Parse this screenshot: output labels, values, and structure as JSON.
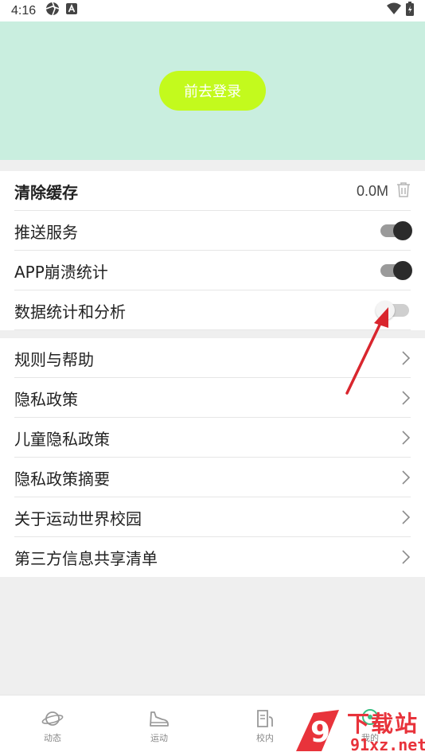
{
  "status_bar": {
    "time": "4:16"
  },
  "header": {
    "login_button": "前去登录"
  },
  "settings": {
    "clear_cache": {
      "label": "清除缓存",
      "size": "0.0M"
    },
    "push_service": {
      "label": "推送服务",
      "enabled": true
    },
    "crash_stats": {
      "label": "APP崩溃统计",
      "enabled": true
    },
    "data_analysis": {
      "label": "数据统计和分析",
      "enabled": false
    }
  },
  "links": [
    {
      "label": "规则与帮助"
    },
    {
      "label": "隐私政策"
    },
    {
      "label": "儿童隐私政策"
    },
    {
      "label": "隐私政策摘要"
    },
    {
      "label": "关于运动世界校园"
    },
    {
      "label": "第三方信息共享清单"
    }
  ],
  "tab_bar": {
    "tabs": [
      {
        "label": "动态",
        "icon": "planet-icon"
      },
      {
        "label": "运动",
        "icon": "shoe-icon"
      },
      {
        "label": "校内",
        "icon": "document-icon"
      },
      {
        "label": "我的",
        "icon": "profile-icon"
      }
    ]
  },
  "watermark": {
    "logo_text": "9",
    "title": "下载站",
    "url": "91xz.net"
  },
  "colors": {
    "banner": "#c9eedf",
    "login_button": "#c3fa1d",
    "toggle_on_knob": "#2b2b2b",
    "annotation_arrow": "#d9262e",
    "watermark": "#e8333b"
  }
}
